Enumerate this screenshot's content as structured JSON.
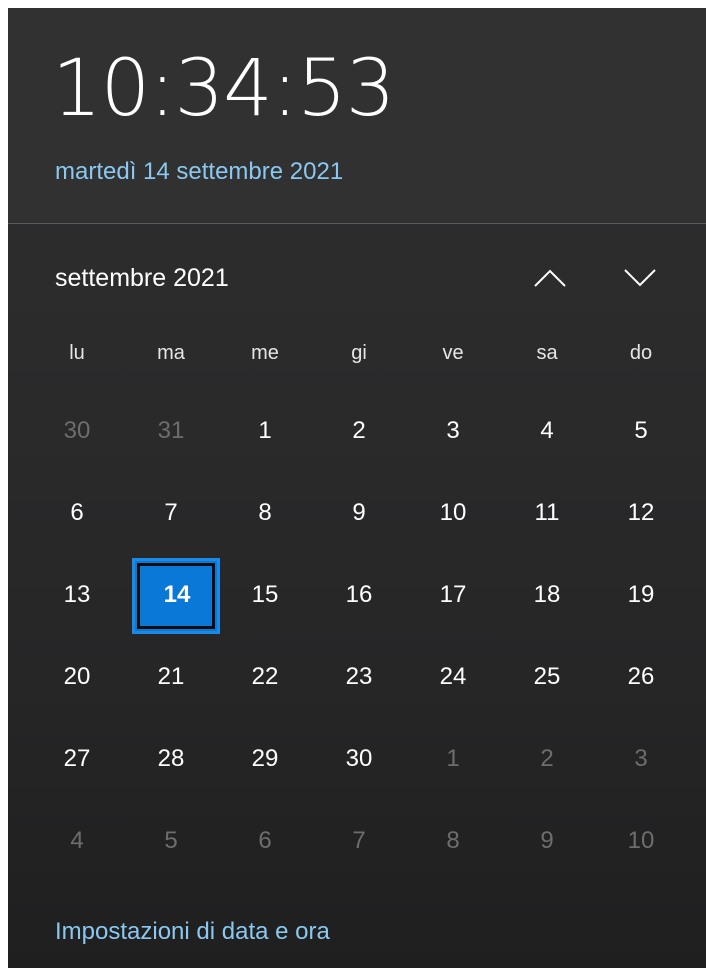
{
  "clock": {
    "time": "10:34:53",
    "date": "martedì 14 settembre 2021"
  },
  "calendar": {
    "month_label": "settembre 2021",
    "nav": {
      "up_icon": "chevron-up-icon",
      "down_icon": "chevron-down-icon"
    },
    "weekdays": [
      "lu",
      "ma",
      "me",
      "gi",
      "ve",
      "sa",
      "do"
    ],
    "weeks": [
      [
        {
          "d": "30",
          "m": true
        },
        {
          "d": "31",
          "m": true
        },
        {
          "d": "1"
        },
        {
          "d": "2"
        },
        {
          "d": "3"
        },
        {
          "d": "4"
        },
        {
          "d": "5"
        }
      ],
      [
        {
          "d": "6"
        },
        {
          "d": "7"
        },
        {
          "d": "8"
        },
        {
          "d": "9"
        },
        {
          "d": "10"
        },
        {
          "d": "11"
        },
        {
          "d": "12"
        }
      ],
      [
        {
          "d": "13"
        },
        {
          "d": "14",
          "s": true
        },
        {
          "d": "15"
        },
        {
          "d": "16"
        },
        {
          "d": "17"
        },
        {
          "d": "18"
        },
        {
          "d": "19"
        }
      ],
      [
        {
          "d": "20"
        },
        {
          "d": "21"
        },
        {
          "d": "22"
        },
        {
          "d": "23"
        },
        {
          "d": "24"
        },
        {
          "d": "25"
        },
        {
          "d": "26"
        }
      ],
      [
        {
          "d": "27"
        },
        {
          "d": "28"
        },
        {
          "d": "29"
        },
        {
          "d": "30"
        },
        {
          "d": "1",
          "m": true
        },
        {
          "d": "2",
          "m": true
        },
        {
          "d": "3",
          "m": true
        }
      ],
      [
        {
          "d": "4",
          "m": true
        },
        {
          "d": "5",
          "m": true
        },
        {
          "d": "6",
          "m": true
        },
        {
          "d": "7",
          "m": true
        },
        {
          "d": "8",
          "m": true
        },
        {
          "d": "9",
          "m": true
        },
        {
          "d": "10",
          "m": true
        }
      ]
    ],
    "selected_color": "#0a78d7"
  },
  "footer": {
    "settings_link": "Impostazioni di data e ora"
  },
  "colors": {
    "link": "#8ac8f0",
    "muted_day": "#6d6d6e"
  }
}
